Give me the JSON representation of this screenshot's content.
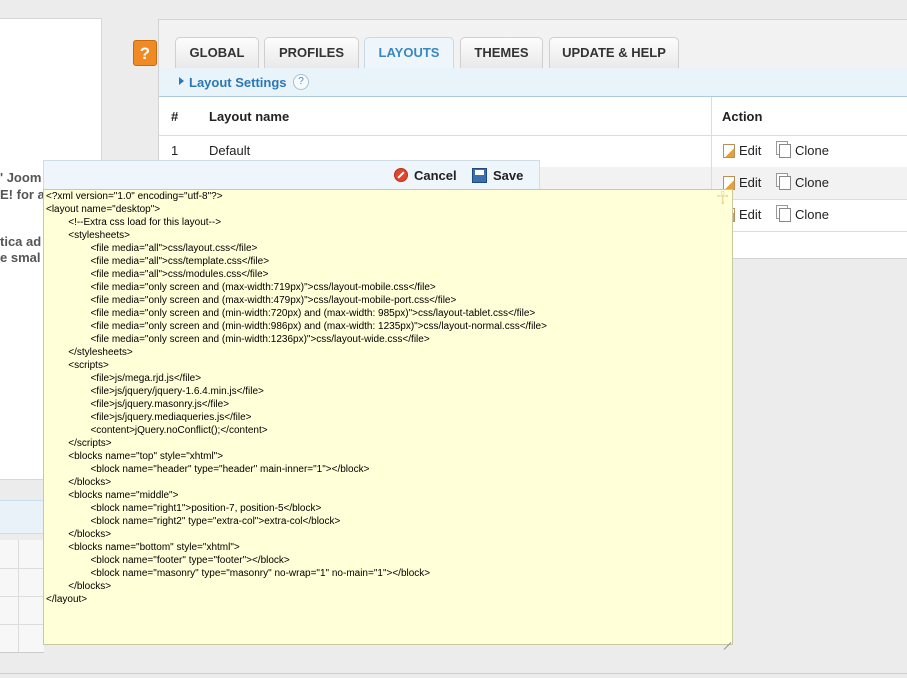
{
  "left": {
    "lines": [
      "' Joom",
      "E! for a",
      "tica ad",
      "e smal"
    ]
  },
  "help_button": {
    "label": "?"
  },
  "tabs": [
    {
      "label": "GLOBAL",
      "active": false
    },
    {
      "label": "PROFILES",
      "active": false
    },
    {
      "label": "LAYOUTS",
      "active": true
    },
    {
      "label": "THEMES",
      "active": false
    },
    {
      "label": "UPDATE & HELP",
      "active": false
    }
  ],
  "subbar": {
    "label": "Layout Settings",
    "help": "?"
  },
  "table": {
    "headers": {
      "num": "#",
      "name": "Layout name",
      "action": "Action"
    },
    "rows": [
      {
        "num": "1",
        "name": "Default"
      },
      {
        "num": "",
        "name": ""
      },
      {
        "num": "",
        "name": ""
      }
    ],
    "edit_label": "Edit",
    "clone_label": "Clone"
  },
  "editor": {
    "cancel_label": "Cancel",
    "save_label": "Save",
    "content": "<?xml version=\"1.0\" encoding=\"utf-8\"?>\n<layout name=\"desktop\">\n        <!--Extra css load for this layout-->\n        <stylesheets>\n                <file media=\"all\">css/layout.css</file>\n                <file media=\"all\">css/template.css</file>\n                <file media=\"all\">css/modules.css</file>\n                <file media=\"only screen and (max-width:719px)\">css/layout-mobile.css</file>\n                <file media=\"only screen and (max-width:479px)\">css/layout-mobile-port.css</file>\n                <file media=\"only screen and (min-width:720px) and (max-width: 985px)\">css/layout-tablet.css</file>\n                <file media=\"only screen and (min-width:986px) and (max-width: 1235px)\">css/layout-normal.css</file>\n                <file media=\"only screen and (min-width:1236px)\">css/layout-wide.css</file>\n        </stylesheets>\n        <scripts>\n                <file>js/mega.rjd.js</file>\n                <file>js/jquery/jquery-1.6.4.min.js</file>\n                <file>js/jquery.masonry.js</file>\n                <file>js/jquery.mediaqueries.js</file>\n                <content>jQuery.noConflict();</content>\n        </scripts>\n        <blocks name=\"top\" style=\"xhtml\">\n                <block name=\"header\" type=\"header\" main-inner=\"1\"></block>\n        </blocks>\n        <blocks name=\"middle\">\n                <block name=\"right1\">position-7, position-5</block>\n                <block name=\"right2\" type=\"extra-col\">extra-col</block>\n        </blocks>\n        <blocks name=\"bottom\" style=\"xhtml\">\n                <block name=\"footer\" type=\"footer\"></block>\n                <block name=\"masonry\" type=\"masonry\" no-wrap=\"1\" no-main=\"1\"></block>\n        </blocks>\n</layout>"
  }
}
